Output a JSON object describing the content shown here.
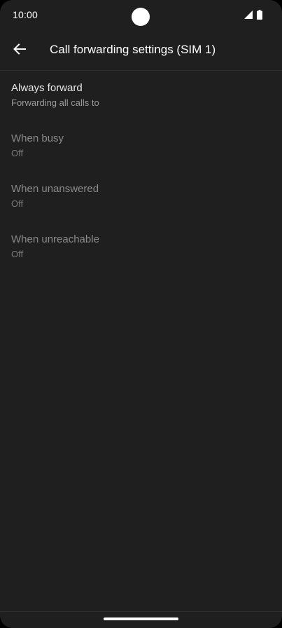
{
  "status_bar": {
    "time": "10:00",
    "icons": [
      "signal-icon",
      "battery-icon"
    ]
  },
  "app_bar": {
    "back_icon": "arrow-back-icon",
    "title": "Call forwarding settings (SIM 1)"
  },
  "items": [
    {
      "title": "Always forward",
      "summary": "Forwarding all calls to",
      "enabled": true
    },
    {
      "title": "When busy",
      "summary": "Off",
      "enabled": false
    },
    {
      "title": "When unanswered",
      "summary": "Off",
      "enabled": false
    },
    {
      "title": "When unreachable",
      "summary": "Off",
      "enabled": false
    }
  ],
  "colors": {
    "background": "#1f1f1f",
    "text_primary": "#e8e8e8",
    "text_disabled": "#8a8a8a"
  }
}
